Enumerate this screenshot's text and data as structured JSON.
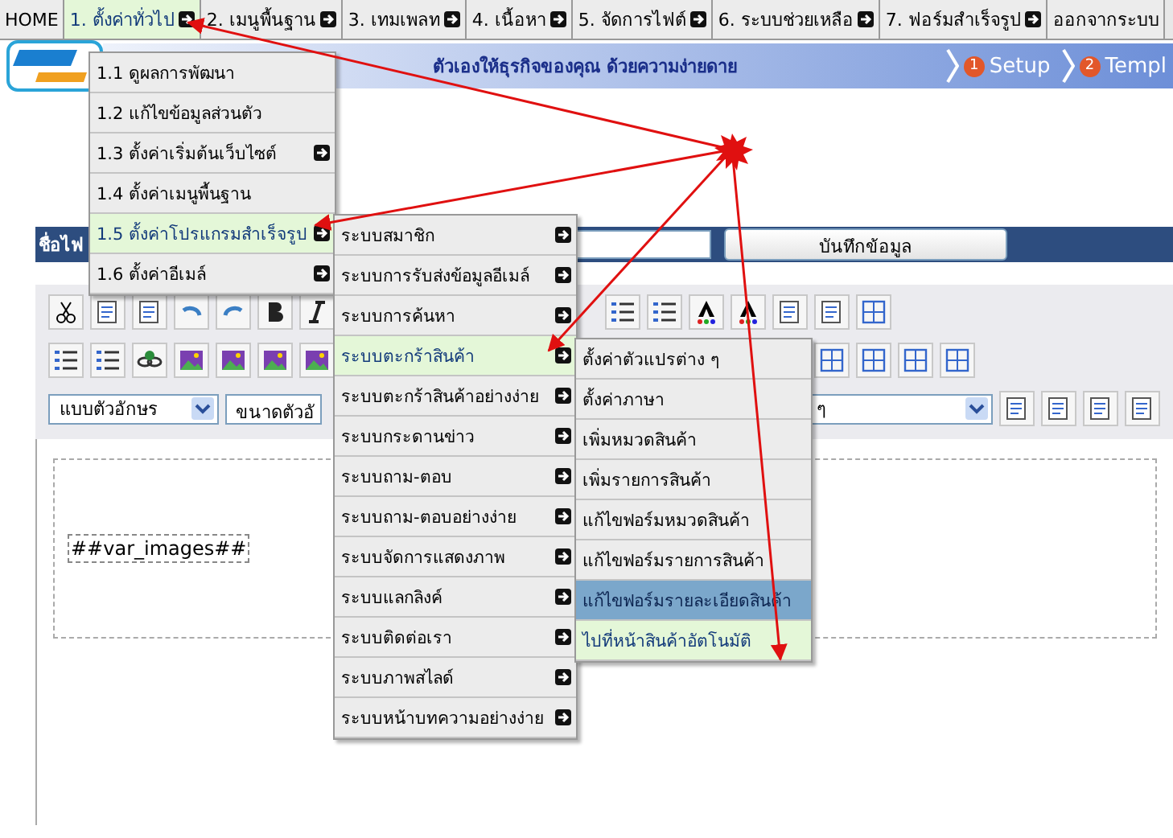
{
  "nav": [
    {
      "label": "HOME",
      "has_submenu": false,
      "selected": false
    },
    {
      "label": "1. ตั้งค่าทั่วไป",
      "has_submenu": true,
      "selected": true
    },
    {
      "label": "2. เมนูพื้นฐาน",
      "has_submenu": true,
      "selected": false
    },
    {
      "label": "3. เทมเพลท",
      "has_submenu": true,
      "selected": false
    },
    {
      "label": "4. เนื้อหา",
      "has_submenu": true,
      "selected": false
    },
    {
      "label": "5. จัดการไฟต์",
      "has_submenu": true,
      "selected": false
    },
    {
      "label": "6. ระบบช่วยเหลือ",
      "has_submenu": true,
      "selected": false
    },
    {
      "label": "7. ฟอร์มสำเร็จรูป",
      "has_submenu": true,
      "selected": false
    },
    {
      "label": "ออกจากระบบ",
      "has_submenu": false,
      "selected": false
    }
  ],
  "banner": {
    "tagline": "ตัวเองให้ธุรกิจของคุณ ด้วยความง่ายดาย",
    "steps": [
      {
        "number": "1",
        "label": "Setup"
      },
      {
        "number": "2",
        "label": "Templ"
      }
    ]
  },
  "file_bar": {
    "label": "ชื่อไฟ",
    "save_button": "บันทึกข้อมูล"
  },
  "toolbar": {
    "font_select": "แบบตัวอักษร",
    "size_select": "ขนาดตัวอั",
    "style_select": "ๆ"
  },
  "editor": {
    "tag": "##var_images##"
  },
  "menus": [
    {
      "items": [
        {
          "label": "1.1 ดูผลการพัฒนา",
          "has_submenu": false,
          "selected": false
        },
        {
          "label": "1.2 แก้ไขข้อมูลส่วนตัว",
          "has_submenu": false,
          "selected": false
        },
        {
          "label": "1.3 ตั้งค่าเริ่มต้นเว็บไซต์",
          "has_submenu": true,
          "selected": false
        },
        {
          "label": "1.4 ตั้งค่าเมนูพื้นฐาน",
          "has_submenu": false,
          "selected": false
        },
        {
          "label": "1.5 ตั้งค่าโปรแกรมสำเร็จรูป",
          "has_submenu": true,
          "selected": true
        },
        {
          "label": "1.6 ตั้งค่าอีเมล์",
          "has_submenu": true,
          "selected": false
        }
      ]
    },
    {
      "items": [
        {
          "label": "ระบบสมาชิก",
          "has_submenu": true,
          "selected": false
        },
        {
          "label": "ระบบการรับส่งข้อมูลอีเมล์",
          "has_submenu": true,
          "selected": false
        },
        {
          "label": "ระบบการค้นหา",
          "has_submenu": true,
          "selected": false
        },
        {
          "label": "ระบบตะกร้าสินค้า",
          "has_submenu": true,
          "selected": true
        },
        {
          "label": "ระบบตะกร้าสินค้าอย่างง่าย",
          "has_submenu": true,
          "selected": false
        },
        {
          "label": "ระบบกระดานข่าว",
          "has_submenu": true,
          "selected": false
        },
        {
          "label": "ระบบถาม-ตอบ",
          "has_submenu": true,
          "selected": false
        },
        {
          "label": "ระบบถาม-ตอบอย่างง่าย",
          "has_submenu": true,
          "selected": false
        },
        {
          "label": "ระบบจัดการแสดงภาพ",
          "has_submenu": true,
          "selected": false
        },
        {
          "label": "ระบบแลกลิงค์",
          "has_submenu": true,
          "selected": false
        },
        {
          "label": "ระบบติดต่อเรา",
          "has_submenu": true,
          "selected": false
        },
        {
          "label": "ระบบภาพสไลด์",
          "has_submenu": true,
          "selected": false
        },
        {
          "label": "ระบบหน้าบทความอย่างง่าย",
          "has_submenu": true,
          "selected": false
        }
      ]
    },
    {
      "items": [
        {
          "label": "ตั้งค่าตัวแปรต่าง ๆ",
          "selected": false,
          "hovered": false
        },
        {
          "label": "ตั้งค่าภาษา",
          "selected": false,
          "hovered": false
        },
        {
          "label": "เพิ่มหมวดสินค้า",
          "selected": false,
          "hovered": false
        },
        {
          "label": "เพิ่มรายการสินค้า",
          "selected": false,
          "hovered": false
        },
        {
          "label": "แก้ไขฟอร์มหมวดสินค้า",
          "selected": false,
          "hovered": false
        },
        {
          "label": "แก้ไขฟอร์มรายการสินค้า",
          "selected": false,
          "hovered": false
        },
        {
          "label": "แก้ไขฟอร์มรายละเอียดสินค้า",
          "selected": false,
          "hovered": true
        },
        {
          "label": "ไปที่หน้าสินค้าอัตโนมัติ",
          "selected": true,
          "hovered": false
        }
      ]
    }
  ]
}
